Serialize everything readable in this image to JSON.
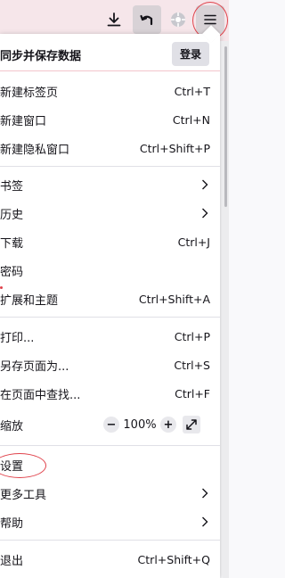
{
  "menu": {
    "sync": {
      "label": "同步并保存数据",
      "login_label": "登录"
    },
    "new_tab": {
      "label": "新建标签页",
      "shortcut": "Ctrl+T"
    },
    "new_window": {
      "label": "新建窗口",
      "shortcut": "Ctrl+N"
    },
    "new_private_window": {
      "label": "新建隐私窗口",
      "shortcut": "Ctrl+Shift+P"
    },
    "bookmarks": {
      "label": "书签"
    },
    "history": {
      "label": "历史"
    },
    "downloads": {
      "label": "下载",
      "shortcut": "Ctrl+J"
    },
    "passwords": {
      "label": "密码"
    },
    "addons": {
      "label": "扩展和主题",
      "shortcut": "Ctrl+Shift+A"
    },
    "print": {
      "label": "打印...",
      "shortcut": "Ctrl+P"
    },
    "save_page": {
      "label": "另存页面为...",
      "shortcut": "Ctrl+S"
    },
    "find": {
      "label": "在页面中查找...",
      "shortcut": "Ctrl+F"
    },
    "zoom": {
      "label": "缩放",
      "value": "100%",
      "minus": "−",
      "plus": "+"
    },
    "settings": {
      "label": "设置"
    },
    "more_tools": {
      "label": "更多工具"
    },
    "help": {
      "label": "帮助"
    },
    "quit": {
      "label": "退出",
      "shortcut": "Ctrl+Shift+Q"
    }
  },
  "toolbar": {
    "icons": [
      "download-icon",
      "back-arrow-icon",
      "extension-icon",
      "hamburger-menu-icon"
    ]
  },
  "colors": {
    "toolbar_bg": "#f6e6ea",
    "annotation_red": "#e0424b"
  }
}
